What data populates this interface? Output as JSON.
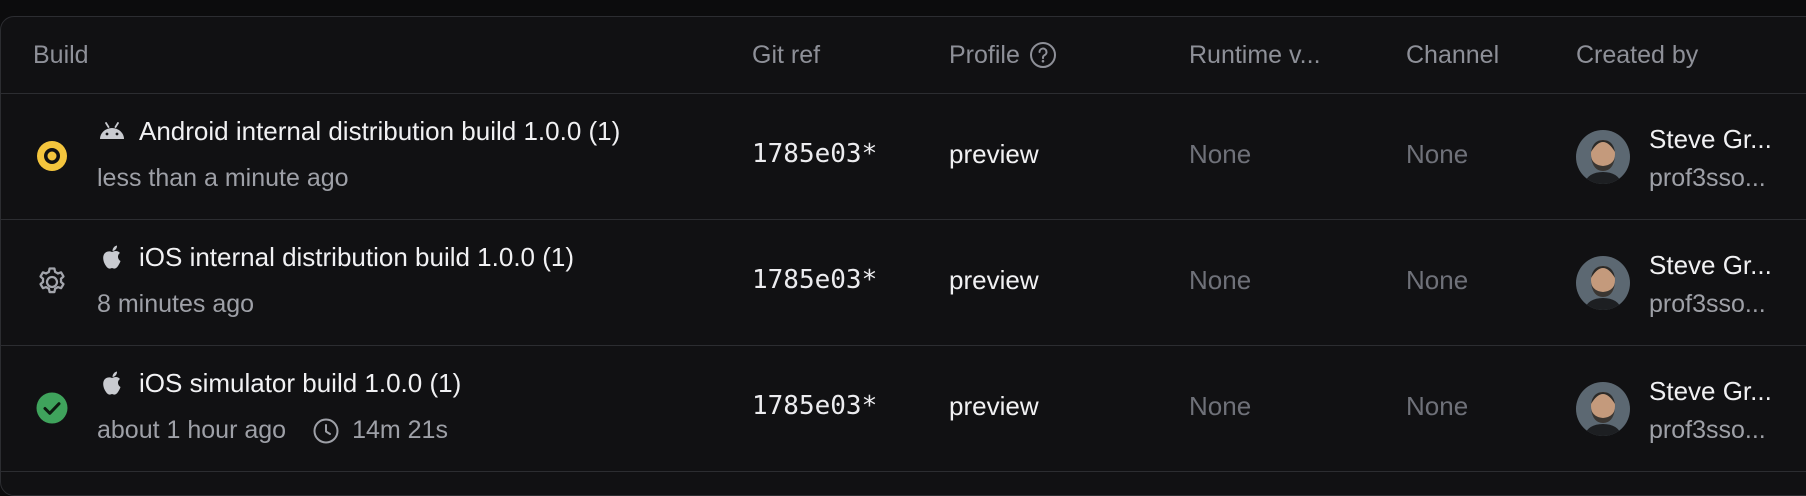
{
  "table": {
    "headers": {
      "build": "Build",
      "git_ref": "Git ref",
      "profile": "Profile",
      "runtime": "Runtime v...",
      "channel": "Channel",
      "created_by": "Created by"
    },
    "rows": [
      {
        "status": "in-progress",
        "platform_icon": "android-icon",
        "title": "Android internal distribution build 1.0.0 (1)",
        "time": "less than a minute ago",
        "duration": "",
        "git_ref": "1785e03*",
        "profile": "preview",
        "runtime": "None",
        "channel": "None",
        "user_name": "Steve Gr...",
        "user_handle": "prof3sso..."
      },
      {
        "status": "queued",
        "platform_icon": "apple-icon",
        "title": "iOS internal distribution build 1.0.0 (1)",
        "time": "8 minutes ago",
        "duration": "",
        "git_ref": "1785e03*",
        "profile": "preview",
        "runtime": "None",
        "channel": "None",
        "user_name": "Steve Gr...",
        "user_handle": "prof3sso..."
      },
      {
        "status": "finished",
        "platform_icon": "apple-icon",
        "title": "iOS simulator build 1.0.0 (1)",
        "time": "about 1 hour ago",
        "duration": "14m 21s",
        "git_ref": "1785e03*",
        "profile": "preview",
        "runtime": "None",
        "channel": "None",
        "user_name": "Steve Gr...",
        "user_handle": "prof3sso..."
      }
    ]
  },
  "colors": {
    "in_progress": "#f4c53d",
    "finished": "#3fa35c",
    "queued": "#a3a5ac"
  }
}
